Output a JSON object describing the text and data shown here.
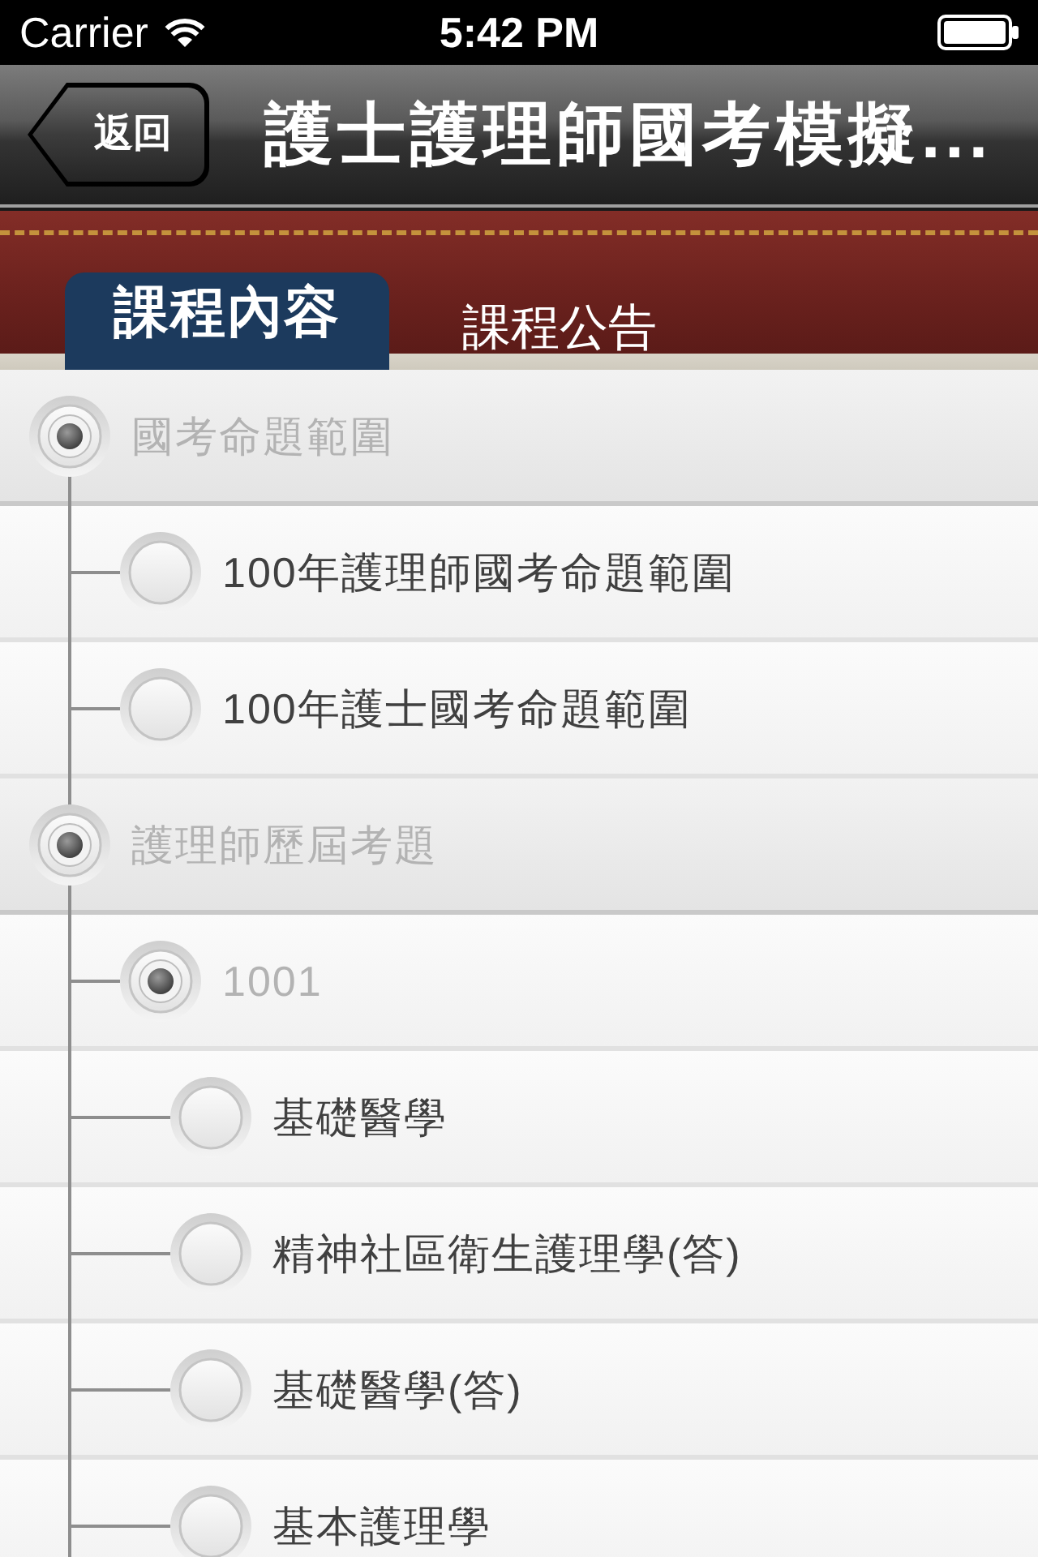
{
  "status_bar": {
    "carrier": "Carrier",
    "time": "5:42 PM"
  },
  "nav_bar": {
    "back_button": "返回",
    "title": "護士護理師國考模擬..."
  },
  "tabs": [
    {
      "label": "課程內容",
      "selected": true
    },
    {
      "label": "課程公告",
      "selected": false
    }
  ],
  "tree": [
    {
      "label": "國考命題範圍",
      "expanded": true,
      "children": [
        {
          "label": "100年護理師國考命題範圍",
          "expanded": false
        },
        {
          "label": "100年護士國考命題範圍",
          "expanded": false
        }
      ]
    },
    {
      "label": "護理師歷屆考題",
      "expanded": true,
      "children": [
        {
          "label": "1001",
          "expanded": true,
          "children": [
            {
              "label": "基礎醫學",
              "expanded": false
            },
            {
              "label": "精神社區衛生護理學(答)",
              "expanded": false
            },
            {
              "label": "基礎醫學(答)",
              "expanded": false
            },
            {
              "label": "基本護理學",
              "expanded": false
            }
          ]
        }
      ]
    }
  ]
}
